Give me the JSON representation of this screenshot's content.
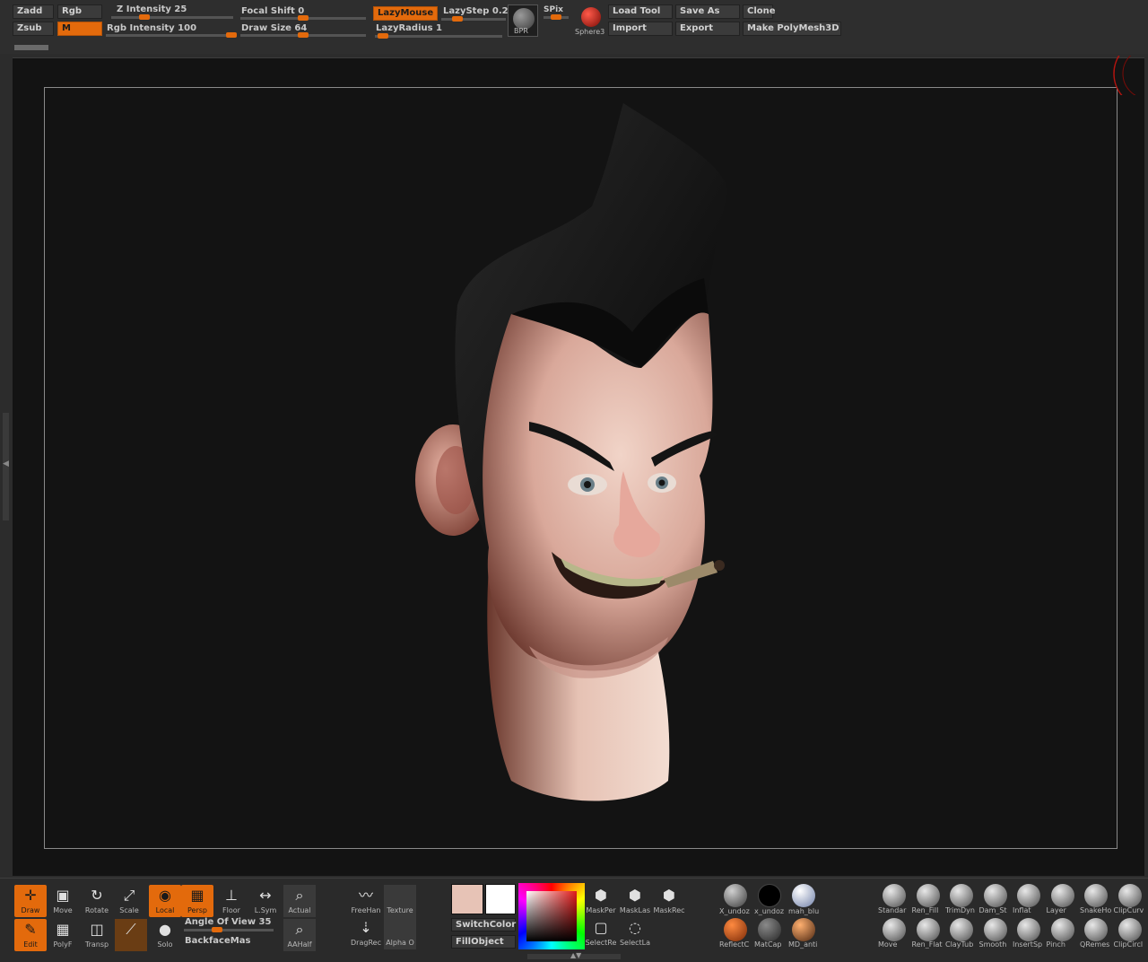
{
  "toolbar": {
    "zadd": "Zadd",
    "zsub": "Zsub",
    "rgb": "Rgb",
    "m": "M",
    "z_intensity": "Z Intensity 25",
    "rgb_intensity": "Rgb Intensity 100",
    "focal_shift": "Focal Shift 0",
    "draw_size": "Draw Size 64",
    "lazy_mouse": "LazyMouse",
    "lazy_step": "LazyStep 0.2:",
    "lazy_radius": "LazyRadius 1",
    "bpr": "BPR",
    "spix": "SPix",
    "sphere": "Sphere3",
    "load_tool": "Load Tool",
    "save_as": "Save As",
    "clone": "Clone",
    "import": "Import",
    "export": "Export",
    "make_polymesh": "Make PolyMesh3D"
  },
  "sliders": {
    "z_intensity": 0.25,
    "rgb_intensity": 1.0,
    "focal_shift": 0.5,
    "draw_size": 0.5,
    "lazy_step": 0.2,
    "lazy_radius": 0.02,
    "angle_of_view": 0.35
  },
  "shelf": {
    "draw": "Draw",
    "move": "Move",
    "rotate": "Rotate",
    "scale": "Scale",
    "local": "Local",
    "persp": "Persp",
    "floor": "Floor",
    "lsym": "L.Sym",
    "actual": "Actual",
    "edit": "Edit",
    "polyf": "PolyF",
    "transp": "Transp",
    "solo": "Solo",
    "angle_of_view": "Angle Of View 35",
    "backface": "BackfaceMas",
    "aahalf": "AAHalf",
    "freehand": "FreeHan",
    "texture": "Texture",
    "dragrect": "DragRec",
    "alpha": "Alpha",
    "alpha_o": "O",
    "switch_color": "SwitchColor",
    "fill_object": "FillObject",
    "mask_per": "MaskPer",
    "mask_las": "MaskLas",
    "mask_rec": "MaskRec",
    "select_re": "SelectRe",
    "select_la": "SelectLa",
    "mat_top": [
      "X_undoz",
      "x_undoz",
      "mah_blu"
    ],
    "mat_bottom": [
      "ReflectC",
      "MatCap",
      "MD_anti"
    ],
    "brushes_top": [
      "Standar",
      "Ren_Fill",
      "TrimDyn",
      "Dam_St",
      "Inflat",
      "Layer",
      "SnakeHo",
      "ClipCurv"
    ],
    "brushes_bottom": [
      "Move",
      "Ren_Flat",
      "ClayTub",
      "Smooth",
      "InsertSp",
      "Pinch",
      "QRemes",
      "ClipCircl"
    ]
  },
  "colors": {
    "accent": "#e36a0c",
    "main_color": "#e7c3b6",
    "secondary_color": "#ffffff"
  }
}
